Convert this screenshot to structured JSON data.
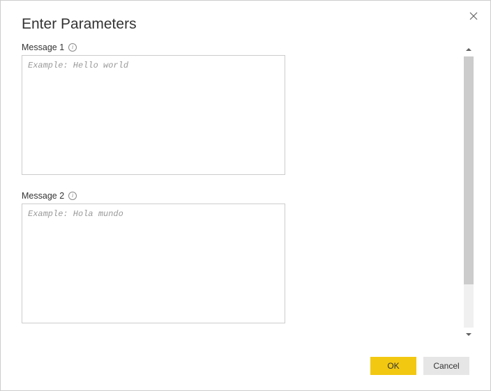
{
  "dialog": {
    "title": "Enter Parameters"
  },
  "fields": [
    {
      "label": "Message 1",
      "placeholder": "Example: Hello world",
      "value": ""
    },
    {
      "label": "Message 2",
      "placeholder": "Example: Hola mundo",
      "value": ""
    }
  ],
  "buttons": {
    "ok": "OK",
    "cancel": "Cancel"
  },
  "colors": {
    "primary": "#f2c811",
    "secondary": "#e6e6e6",
    "border": "#cccccc"
  }
}
